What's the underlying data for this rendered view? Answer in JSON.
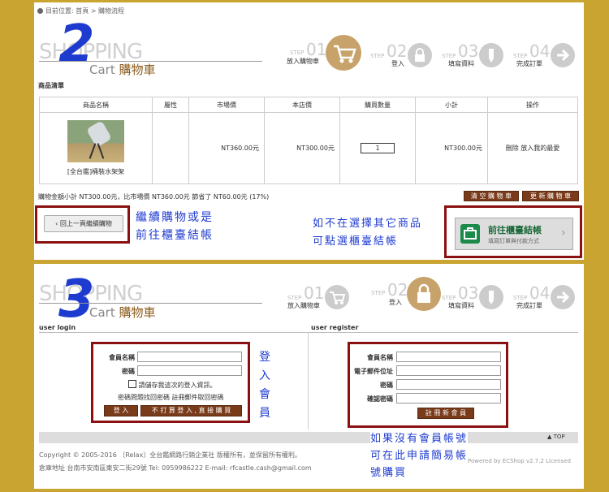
{
  "panel1": {
    "breadcrumb": "目前位置: 首頁 > 購物流程",
    "big_number": "2",
    "shopping_word": "SHOPPING",
    "cart_word": "Cart",
    "cart_cn": "購物車",
    "steps": [
      {
        "lbl": "STEP",
        "num": "01",
        "cap": "放入購物車"
      },
      {
        "lbl": "STEP",
        "num": "02",
        "cap": "登入"
      },
      {
        "lbl": "STEP",
        "num": "03",
        "cap": "填寫資料"
      },
      {
        "lbl": "STEP",
        "num": "04",
        "cap": "完成訂單"
      }
    ],
    "section_title": "商品清單",
    "table_headers": [
      "商品名稱",
      "屬性",
      "市場價",
      "本店價",
      "購買數量",
      "小計",
      "操作"
    ],
    "row": {
      "product_name": "[全台鑑]桶裝水架架",
      "attr": "",
      "market_price": "NT360.00元",
      "shop_price": "NT300.00元",
      "qty": "1",
      "subtotal": "NT300.00元",
      "ops": "刪除  放入我的最愛"
    },
    "summary": "購物金額小計 NT300.00元，比市場價 NT360.00元 節省了 NT60.00元 (17%)",
    "clear_cart": "清 空 購 物 車",
    "update_cart": "更 新 購 物 車",
    "back_button": "回上一頁繼續購物",
    "note_left": [
      "繼續購物或是",
      "前往櫃臺結帳"
    ],
    "note_right": [
      "如不在選擇其它商品",
      "可點選櫃臺結帳"
    ],
    "checkout_title": "前往櫃臺結帳",
    "checkout_sub": "填寫訂單與付款方式"
  },
  "panel2": {
    "big_number": "3",
    "shopping_word": "SHOPPING",
    "cart_word": "Cart",
    "cart_cn": "購物車",
    "steps": [
      {
        "lbl": "STEP",
        "num": "01",
        "cap": "放入購物車"
      },
      {
        "lbl": "STEP",
        "num": "02",
        "cap": "登入"
      },
      {
        "lbl": "STEP",
        "num": "03",
        "cap": "填寫資料"
      },
      {
        "lbl": "STEP",
        "num": "04",
        "cap": "完成訂單"
      }
    ],
    "login_title": "user login",
    "register_title": "user register",
    "login": {
      "username_label": "會員名稱",
      "password_label": "密碼",
      "remember": "請儲存我這次的登入資訊。",
      "forgot": "密碼問題找回密碼  註冊郵件取回密碼",
      "login_btn": "登 入",
      "guest_btn": "不 打 算 登 入 , 直 接 購 買"
    },
    "register": {
      "username_label": "會員名稱",
      "email_label": "電子郵件位址",
      "password_label": "密碼",
      "confirm_label": "確認密碼",
      "register_btn": "註 冊 新 會 員"
    },
    "note_login": [
      "登",
      "入",
      "會",
      "員"
    ],
    "note_register": [
      "如果沒有會員帳號",
      "可在此申請簡易帳",
      "號購買"
    ],
    "top_link": "TOP",
    "footer_line1": "Copyright © 2005-2016 〔Relax〕全台鑑網路行銷企業社 版權所有，並保留所有權利。",
    "footer_line2": "倉庫地址 台南市安南區東安二街29號 Tel: 0959986222 E-mail: rfcastle.cash@gmail.com",
    "powered": "Powered by ECShop v2.7.2 Licensed"
  }
}
